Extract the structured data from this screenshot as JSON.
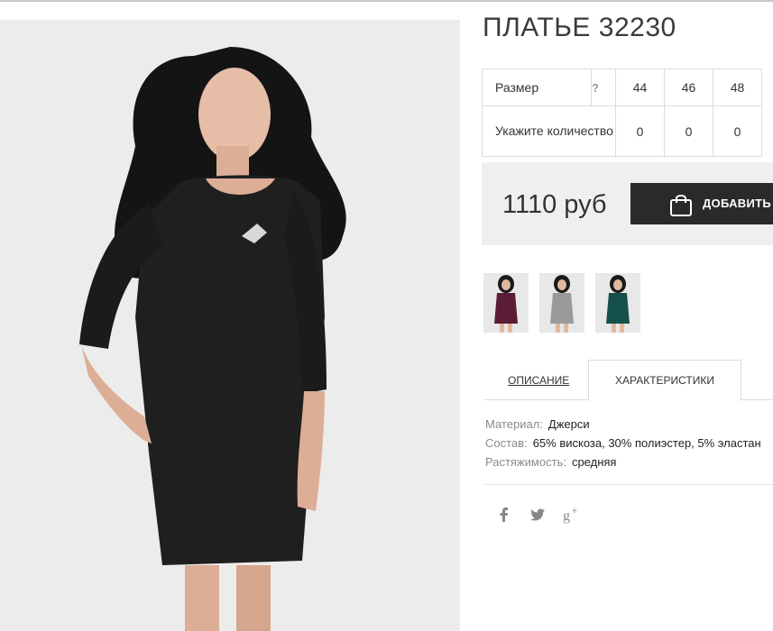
{
  "product": {
    "title": "ПЛАТЬЕ 32230"
  },
  "size_table": {
    "size_label": "Размер",
    "help_mark": "?",
    "sizes": [
      "44",
      "46",
      "48"
    ],
    "qty_label": "Укажите количество",
    "quantities": [
      "0",
      "0",
      "0"
    ]
  },
  "price": {
    "text": "1110 руб"
  },
  "cart_button": {
    "label": "ДОБАВИТЬ В"
  },
  "thumbnails": [
    {
      "color": "#5a1c36"
    },
    {
      "color": "#9a9a9a"
    },
    {
      "color": "#16504a"
    }
  ],
  "tabs": {
    "description": "ОПИСАНИЕ",
    "characteristics": "ХАРАКТЕРИСТИКИ"
  },
  "specs": [
    {
      "key": "Материал:",
      "value": "Джерси"
    },
    {
      "key": "Состав:",
      "value": "65% вискоза, 30% полиэстер, 5% эластан"
    },
    {
      "key": "Растяжимость:",
      "value": "средняя"
    }
  ],
  "social": {
    "facebook": "f",
    "googleplus": "g+"
  }
}
